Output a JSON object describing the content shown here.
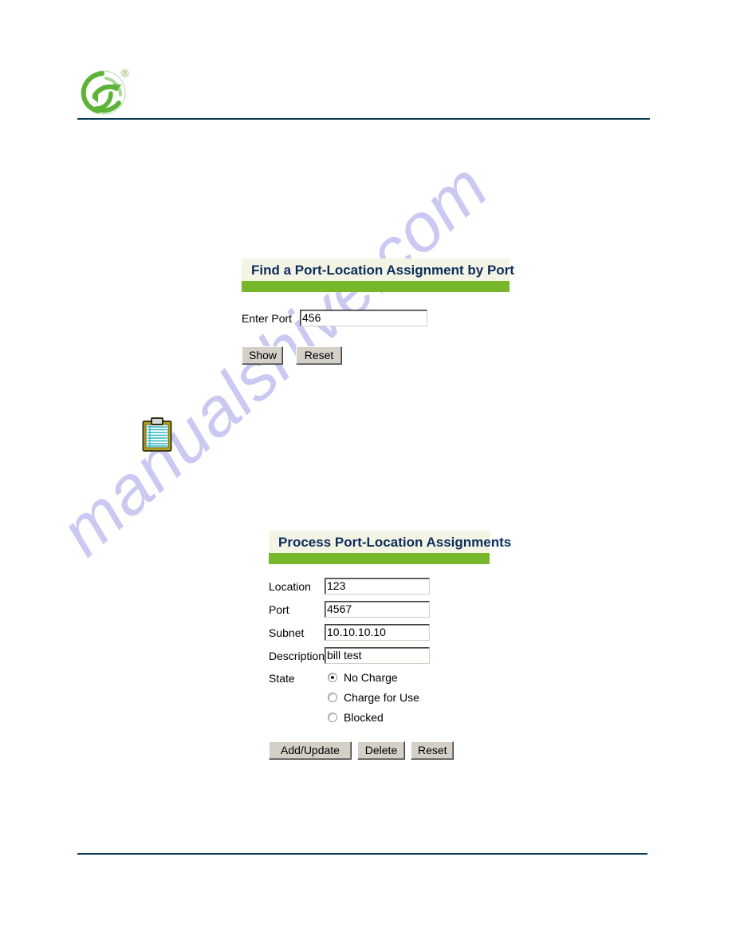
{
  "document": {
    "watermark": "manualshive.com",
    "brand_logo_name": "green-swirl-logo",
    "trademark_symbol": "®",
    "rule_color": "#0b3c53"
  },
  "colors": {
    "panel_header_bg": "#f4f4e4",
    "panel_bar_green": "#76b82a",
    "panel_title_navy": "#0b2d5c",
    "button_face": "#d4d0c8",
    "logo_green": "#5cb335"
  },
  "find_panel": {
    "title": "Find a Port-Location Assignment by Port",
    "fields": [
      {
        "label": "Enter Port",
        "value": "456",
        "placeholder": ""
      }
    ],
    "buttons": [
      {
        "label": "Show"
      },
      {
        "label": "Reset"
      }
    ]
  },
  "note_icon": {
    "name": "clipboard-note-icon"
  },
  "process_panel": {
    "title": "Process Port-Location Assignments",
    "fields": [
      {
        "label": "Location",
        "value": "123",
        "placeholder": ""
      },
      {
        "label": "Port",
        "value": "4567",
        "placeholder": ""
      },
      {
        "label": "Subnet",
        "value": "10.10.10.10",
        "placeholder": ""
      },
      {
        "label": "Description",
        "value": "bill test",
        "placeholder": ""
      }
    ],
    "state": {
      "label": "State",
      "options": [
        {
          "label": "No Charge",
          "selected": true
        },
        {
          "label": "Charge for Use",
          "selected": false
        },
        {
          "label": "Blocked",
          "selected": false
        }
      ]
    },
    "buttons": [
      {
        "label": "Add/Update"
      },
      {
        "label": "Delete"
      },
      {
        "label": "Reset"
      }
    ]
  }
}
